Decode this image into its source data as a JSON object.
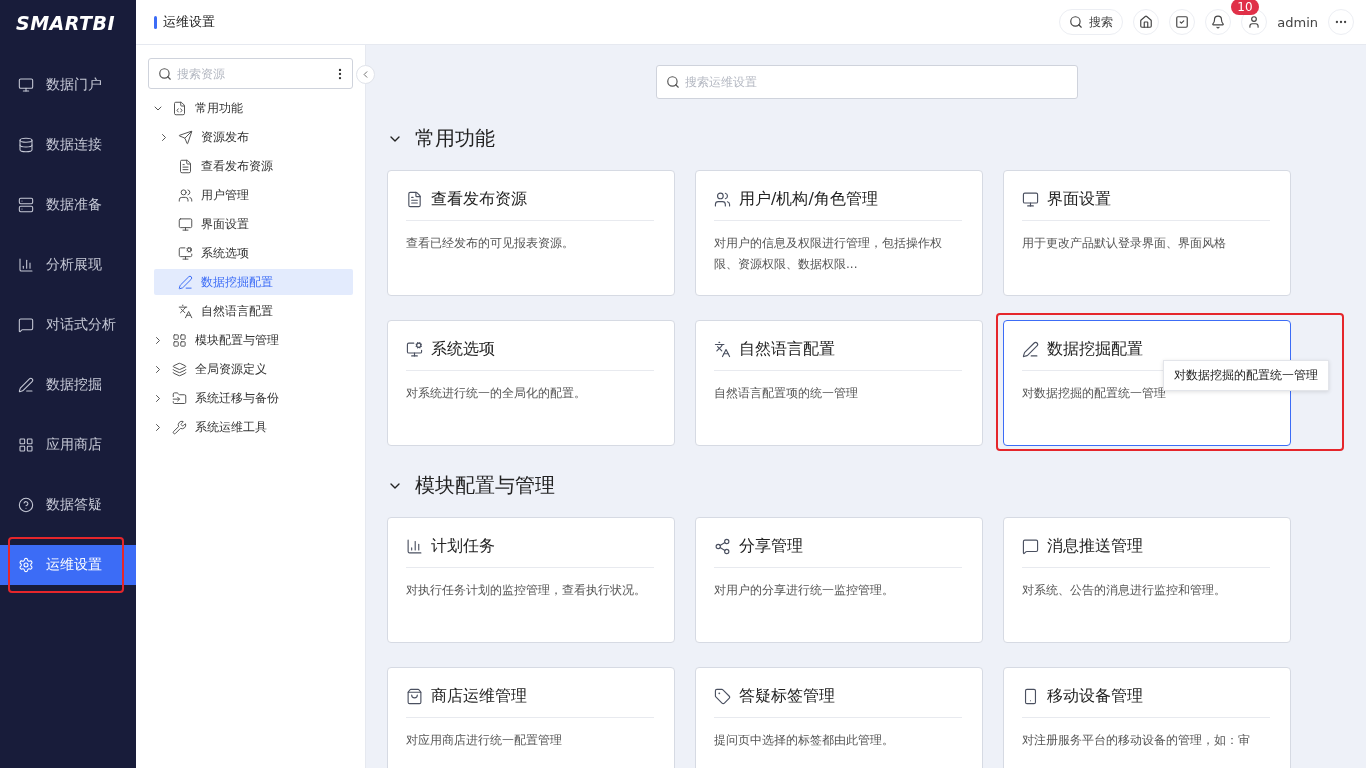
{
  "logo": "SMARTBI",
  "nav": [
    {
      "label": "数据门户",
      "selected": false,
      "highlighted": false
    },
    {
      "label": "数据连接",
      "selected": false,
      "highlighted": false
    },
    {
      "label": "数据准备",
      "selected": false,
      "highlighted": false
    },
    {
      "label": "分析展现",
      "selected": false,
      "highlighted": false
    },
    {
      "label": "对话式分析",
      "selected": false,
      "highlighted": false
    },
    {
      "label": "数据挖掘",
      "selected": false,
      "highlighted": false
    },
    {
      "label": "应用商店",
      "selected": false,
      "highlighted": false
    },
    {
      "label": "数据答疑",
      "selected": false,
      "highlighted": false
    },
    {
      "label": "运维设置",
      "selected": true,
      "highlighted": true
    }
  ],
  "header": {
    "title": "运维设置",
    "search_label": "搜索",
    "notifications": "10",
    "user": "admin"
  },
  "tree": {
    "search": {
      "placeholder": "搜索资源"
    },
    "items": [
      {
        "label": "常用功能",
        "kind": "folder",
        "expanded": true,
        "selected": false,
        "children": [
          {
            "label": "资源发布",
            "kind": "folder",
            "expanded": false,
            "selected": false
          },
          {
            "label": "查看发布资源",
            "kind": "leaf",
            "selected": false
          },
          {
            "label": "用户管理",
            "kind": "leaf",
            "selected": false
          },
          {
            "label": "界面设置",
            "kind": "leaf",
            "selected": false
          },
          {
            "label": "系统选项",
            "kind": "leaf",
            "selected": false
          },
          {
            "label": "数据挖掘配置",
            "kind": "leaf",
            "selected": true
          },
          {
            "label": "自然语言配置",
            "kind": "leaf",
            "selected": false
          }
        ]
      },
      {
        "label": "模块配置与管理",
        "kind": "folder",
        "expanded": false,
        "selected": false
      },
      {
        "label": "全局资源定义",
        "kind": "folder",
        "expanded": false,
        "selected": false
      },
      {
        "label": "系统迁移与备份",
        "kind": "folder",
        "expanded": false,
        "selected": false
      },
      {
        "label": "系统运维工具",
        "kind": "folder",
        "expanded": false,
        "selected": false
      }
    ]
  },
  "main_search": {
    "placeholder": "搜索运维设置"
  },
  "sections": [
    {
      "title": "常用功能",
      "expanded": true,
      "cards": [
        {
          "title": "查看发布资源",
          "description": "查看已经发布的可见报表资源。",
          "active": false,
          "highlighted": false
        },
        {
          "title": "用户/机构/角色管理",
          "description": "对用户的信息及权限进行管理，包括操作权限、资源权限、数据权限...",
          "active": false,
          "highlighted": false
        },
        {
          "title": "界面设置",
          "description": "用于更改产品默认登录界面、界面风格",
          "active": false,
          "highlighted": false
        },
        {
          "title": "系统选项",
          "description": "对系统进行统一的全局化的配置。",
          "active": false,
          "highlighted": false
        },
        {
          "title": "自然语言配置",
          "description": "自然语言配置项的统一管理",
          "active": false,
          "highlighted": false
        },
        {
          "title": "数据挖掘配置",
          "description": "对数据挖掘的配置统一管理",
          "active": true,
          "highlighted": true,
          "tooltip": "对数据挖掘的配置统一管理"
        }
      ]
    },
    {
      "title": "模块配置与管理",
      "expanded": true,
      "cards": [
        {
          "title": "计划任务",
          "description": "对执行任务计划的监控管理，查看执行状况。",
          "active": false,
          "highlighted": false
        },
        {
          "title": "分享管理",
          "description": "对用户的分享进行统一监控管理。",
          "active": false,
          "highlighted": false
        },
        {
          "title": "消息推送管理",
          "description": "对系统、公告的消息进行监控和管理。",
          "active": false,
          "highlighted": false
        },
        {
          "title": "商店运维管理",
          "description": "对应用商店进行统一配置管理",
          "active": false,
          "highlighted": false
        },
        {
          "title": "答疑标签管理",
          "description": "提问页中选择的标签都由此管理。",
          "active": false,
          "highlighted": false
        },
        {
          "title": "移动设备管理",
          "description": "对注册服务平台的移动设备的管理，如：审",
          "active": false,
          "highlighted": false
        }
      ]
    }
  ]
}
